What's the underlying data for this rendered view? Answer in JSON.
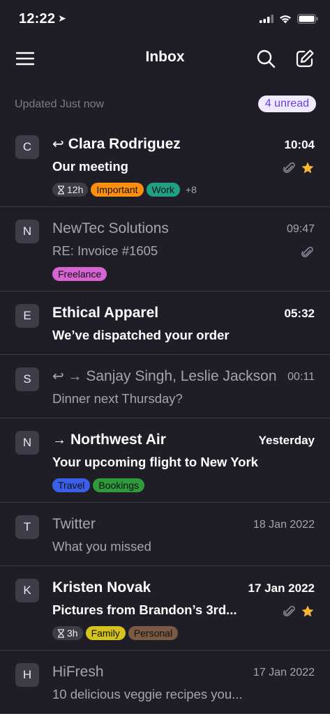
{
  "status_bar": {
    "time": "12:22"
  },
  "nav": {
    "title": "Inbox"
  },
  "sub_header": {
    "updated": "Updated Just now",
    "unread_count": "4 unread"
  },
  "colors": {
    "background": "#1f1e26",
    "accent": "#6a3df0",
    "star": "#f5b633"
  },
  "messages": [
    {
      "initial": "C",
      "sender": "Clara Rodriguez",
      "subject": "Our meeting",
      "time": "10:04",
      "arrows": "↩",
      "unread": true,
      "timer": "12h",
      "tags": [
        {
          "label": "Important",
          "color": "#ff8f0f"
        },
        {
          "label": "Work",
          "color": "#1fa184"
        }
      ],
      "more": "+8",
      "attachment": true,
      "starred": true
    },
    {
      "initial": "N",
      "sender": "NewTec Solutions",
      "subject": "RE: Invoice #1605",
      "time": "09:47",
      "arrows": "",
      "unread": false,
      "tags": [
        {
          "label": "Freelance",
          "color": "#d863d3"
        }
      ],
      "attachment": true
    },
    {
      "initial": "E",
      "sender": "Ethical Apparel",
      "subject": "We’ve dispatched your order",
      "time": "05:32",
      "arrows": "",
      "unread": true
    },
    {
      "initial": "S",
      "sender": "Sanjay Singh, Leslie Jackson",
      "subject": "Dinner next Thursday?",
      "time": "00:11",
      "arrows": "↩ →",
      "unread": false
    },
    {
      "initial": "N",
      "sender": "Northwest Air",
      "subject": "Your upcoming flight to New York",
      "time": "Yesterday",
      "arrows": "→",
      "unread": true,
      "tags": [
        {
          "label": "Travel",
          "color": "#3b5fe8"
        },
        {
          "label": "Bookings",
          "color": "#2f9a3c"
        }
      ]
    },
    {
      "initial": "T",
      "sender": "Twitter",
      "subject": "What you missed",
      "time": "18 Jan 2022",
      "arrows": "",
      "unread": false
    },
    {
      "initial": "K",
      "sender": "Kristen Novak",
      "subject": "Pictures from Brandon’s 3rd...",
      "time": "17 Jan 2022",
      "arrows": "",
      "unread": true,
      "timer": "3h",
      "tags": [
        {
          "label": "Family",
          "color": "#d6c21c"
        },
        {
          "label": "Personal",
          "color": "#7b5a44"
        }
      ],
      "attachment": true,
      "starred": true
    },
    {
      "initial": "H",
      "sender": "HiFresh",
      "subject": "10 delicious veggie recipes you...",
      "time": "17 Jan 2022",
      "arrows": "",
      "unread": false
    }
  ]
}
